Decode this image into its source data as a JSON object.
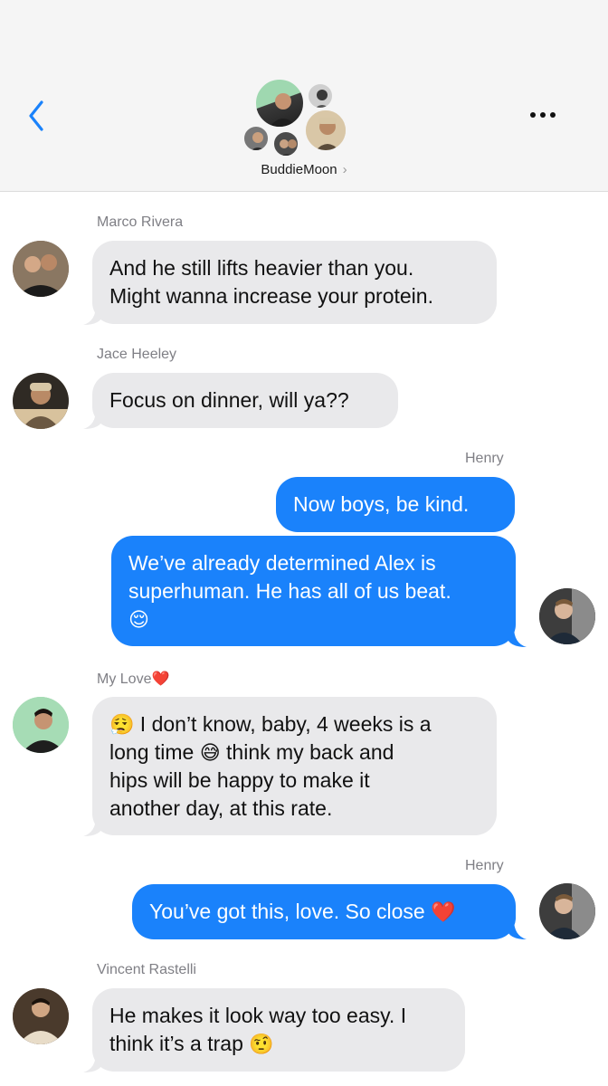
{
  "header": {
    "group_name": "BuddieMoon",
    "chevron": "›",
    "back_icon": "chevron-left-icon",
    "more_icon": "ellipsis-icon",
    "accent": "#1a82fb"
  },
  "colors": {
    "outgoing": "#1a82fb",
    "incoming": "#e9e9eb",
    "sender_label": "#7f7f85"
  },
  "messages": [
    {
      "sender": "Marco Rivera",
      "direction": "incoming",
      "lines": [
        "And he still lifts heavier than you.",
        "Might wanna increase your protein."
      ]
    },
    {
      "sender": "Jace Heeley",
      "direction": "incoming",
      "lines": [
        "Focus on dinner, will ya??"
      ]
    },
    {
      "sender": "Henry",
      "direction": "outgoing",
      "lines": [
        "Now boys, be kind."
      ]
    },
    {
      "sender": "Henry",
      "direction": "outgoing",
      "lines": [
        "We’ve already determined Alex is",
        "superhuman. He has all of us beat."
      ],
      "emoji": "😌"
    },
    {
      "sender": "My Love",
      "sender_emoji": "❤️",
      "direction": "incoming",
      "lead_emoji": "😮‍💨",
      "lines": [
        "I don’t know, baby, 4 weeks is a",
        "long time",
        "think my back and",
        "hips will be happy to make it",
        "another day, at this rate."
      ],
      "inline_emoji": "😅"
    },
    {
      "sender": "Henry",
      "direction": "outgoing",
      "lines": [
        "You’ve got this, love. So close"
      ],
      "emoji": "❤️"
    },
    {
      "sender": "Vincent Rastelli",
      "direction": "incoming",
      "lines": [
        "He makes it look way too easy. I",
        "think it’s a trap"
      ],
      "emoji": "🤨"
    }
  ]
}
